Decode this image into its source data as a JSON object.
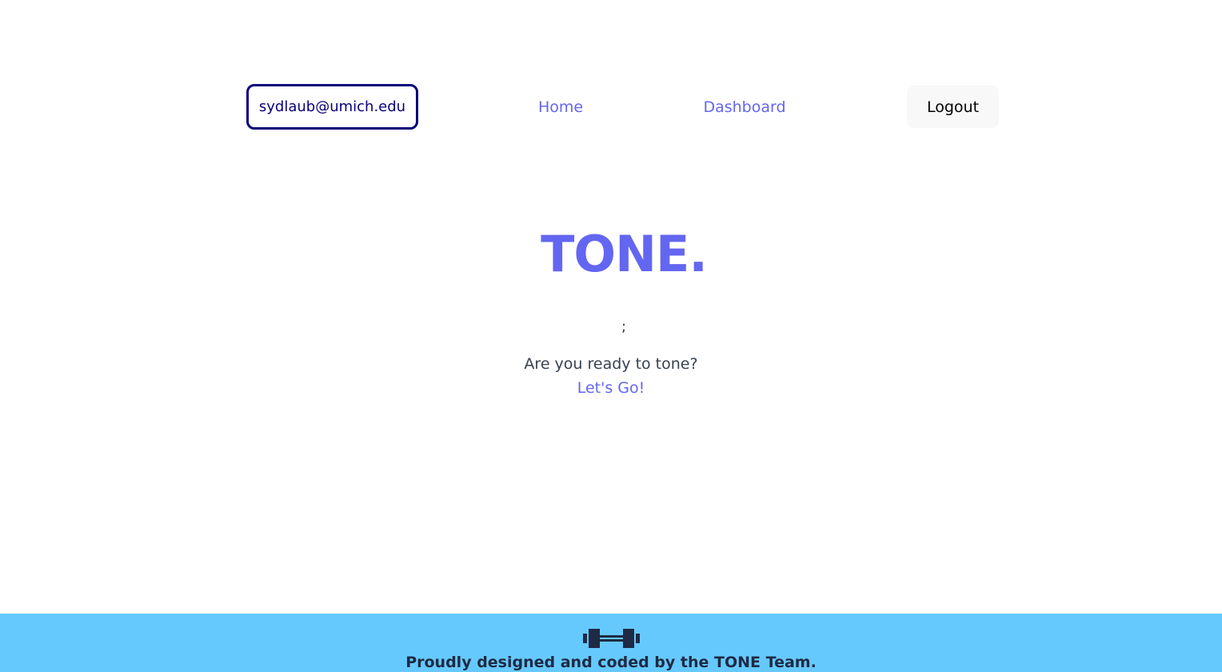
{
  "nav": {
    "user_email": "sydlaub@umich.edu",
    "home_label": "Home",
    "dashboard_label": "Dashboard",
    "logout_label": "Logout"
  },
  "hero": {
    "title": "TONE.",
    "semicolon": ";",
    "prompt": "Are you ready to tone?",
    "cta_label": "Let's Go!"
  },
  "footer": {
    "icon": "dumbbell-icon",
    "text": "Proudly designed and coded by the TONE Team."
  },
  "colors": {
    "accent": "#6366f1",
    "badge_border": "#08007a",
    "footer_bg": "#66c9fd",
    "footer_text": "#1f2a44"
  }
}
